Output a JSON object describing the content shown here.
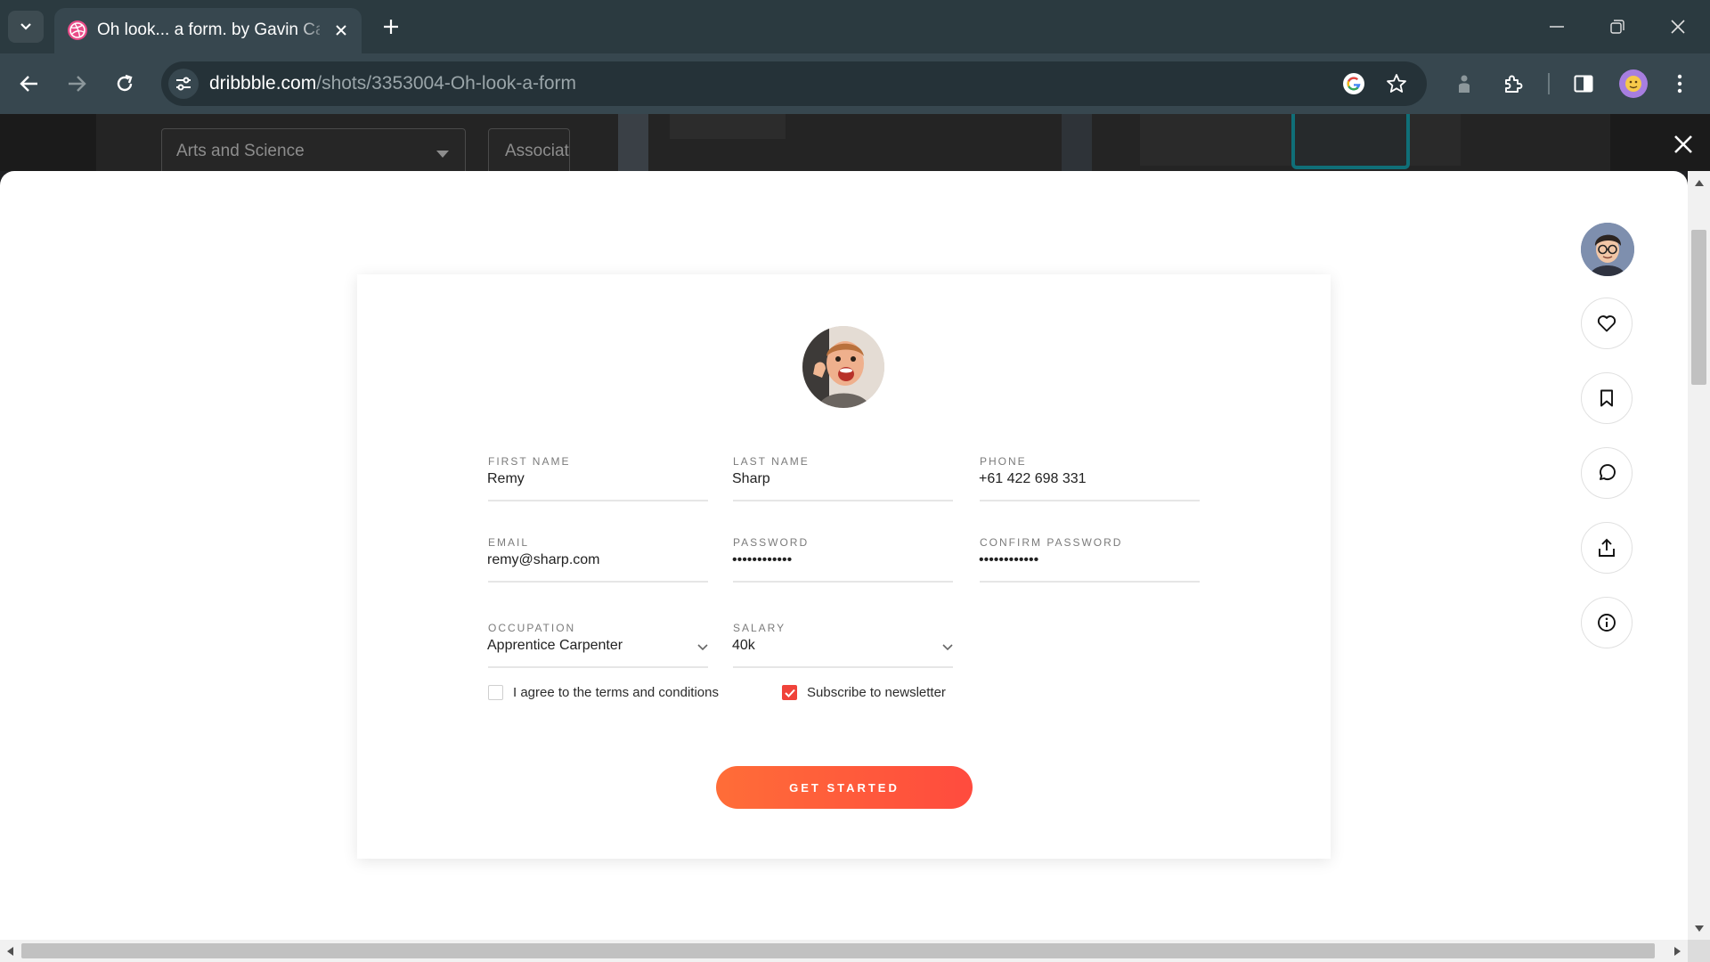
{
  "browser": {
    "tab_title": "Oh look... a form. by Gavin Carr",
    "url_host": "dribbble.com",
    "url_path": "/shots/3353004-Oh-look-a-form"
  },
  "backdrop": {
    "select_value": "Arts and Science",
    "input_value": "Associate"
  },
  "form": {
    "first_name": {
      "label": "FIRST NAME",
      "value": "Remy"
    },
    "last_name": {
      "label": "LAST NAME",
      "value": "Sharp"
    },
    "phone": {
      "label": "PHONE",
      "value": "+61 422 698 331"
    },
    "email": {
      "label": "EMAIL",
      "value": "remy@sharp.com"
    },
    "password": {
      "label": "PASSWORD",
      "value": "••••••••••••"
    },
    "confirm_password": {
      "label": "CONFIRM PASSWORD",
      "value": "••••••••••••"
    },
    "occupation": {
      "label": "OCCUPATION",
      "value": "Apprentice Carpenter"
    },
    "salary": {
      "label": "SALARY",
      "value": "40k"
    },
    "terms": {
      "label": "I agree to the terms and conditions",
      "checked": false
    },
    "newsletter": {
      "label": "Subscribe to newsletter",
      "checked": true
    },
    "cta_label": "GET STARTED"
  },
  "colors": {
    "accent": "#f0433a",
    "cta_start": "#ff6d38",
    "cta_end": "#ff4b3e"
  },
  "icons": {
    "rail": [
      "heart-icon",
      "bookmark-icon",
      "comment-icon",
      "share-icon",
      "info-icon"
    ]
  }
}
